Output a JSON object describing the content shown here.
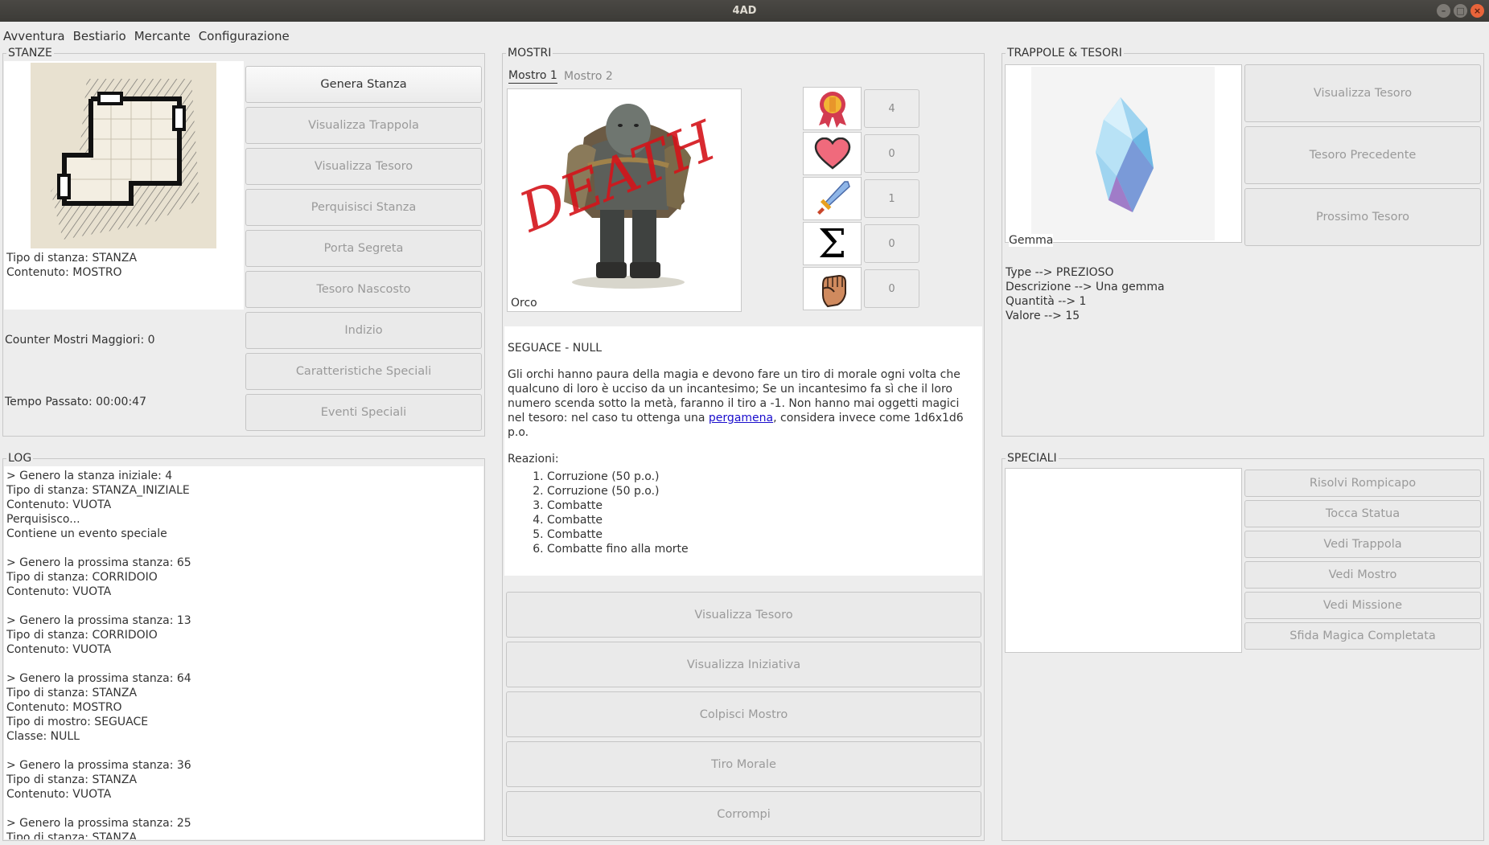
{
  "window": {
    "title": "4AD"
  },
  "menu": [
    "Avventura",
    "Bestiario",
    "Mercante",
    "Configurazione"
  ],
  "stanze": {
    "title": "STANZE",
    "tipo": "Tipo di stanza: STANZA",
    "contenuto": "Contenuto: MOSTRO",
    "counter": "Counter Mostri Maggiori: 0",
    "tempo": "Tempo Passato: 00:00:47",
    "buttons": [
      "Genera Stanza",
      "Visualizza Trappola",
      "Visualizza Tesoro",
      "Perquisisci Stanza",
      "Porta Segreta",
      "Tesoro Nascosto",
      "Indizio",
      "Caratteristiche Speciali",
      "Eventi Speciali"
    ]
  },
  "mostri": {
    "title": "MOSTRI",
    "tabs": [
      "Mostro 1",
      "Mostro 2"
    ],
    "image_caption": "Orco",
    "image_overlay": "DEATH",
    "stats": [
      {
        "icon": "medal-icon",
        "value": "4"
      },
      {
        "icon": "heart-icon",
        "value": "0"
      },
      {
        "icon": "sword-icon",
        "value": "1"
      },
      {
        "icon": "sigma-icon",
        "value": "0"
      },
      {
        "icon": "fist-icon",
        "value": "0"
      }
    ],
    "heading": "SEGUACE - NULL",
    "description_before": "Gli orchi hanno paura della magia e devono fare un tiro di morale ogni volta che qualcuno di loro è ucciso da un incantesimo; Se un incantesimo fa sì che il loro numero scenda sotto la metà, faranno il tiro a -1. Non hanno mai oggetti magici nel tesoro: nel caso tu ottenga una ",
    "description_link": "pergamena",
    "description_after": ", considera invece come 1d6x1d6 p.o.",
    "reactions_title": "Reazioni:",
    "reactions": [
      "Corruzione (50 p.o.)",
      "Corruzione (50 p.o.)",
      "Combatte",
      "Combatte",
      "Combatte",
      "Combatte fino alla morte"
    ],
    "buttons": [
      "Visualizza Tesoro",
      "Visualizza Iniziativa",
      "Colpisci Mostro",
      "Tiro Morale",
      "Corrompi"
    ]
  },
  "trappole": {
    "title": "TRAPPOLE & TESORI",
    "image_caption": "Gemma",
    "info": [
      "Type --> PREZIOSO",
      "Descrizione --> Una gemma",
      "Quantità --> 1",
      "Valore --> 15"
    ],
    "buttons": [
      "Visualizza Tesoro",
      "Tesoro Precedente",
      "Prossimo Tesoro"
    ]
  },
  "log": {
    "title": "LOG",
    "lines": [
      "> Genero la stanza iniziale: 4",
      "Tipo di stanza: STANZA_INIZIALE",
      "Contenuto: VUOTA",
      "Perquisisco...",
      "Contiene un evento speciale",
      "",
      "> Genero la prossima stanza: 65",
      "Tipo di stanza: CORRIDOIO",
      "Contenuto: VUOTA",
      "",
      "> Genero la prossima stanza: 13",
      "Tipo di stanza: CORRIDOIO",
      "Contenuto: VUOTA",
      "",
      "> Genero la prossima stanza: 64",
      "Tipo di stanza: STANZA",
      "Contenuto: MOSTRO",
      "Tipo di mostro: SEGUACE",
      "Classe: NULL",
      "",
      "> Genero la prossima stanza: 36",
      "Tipo di stanza: STANZA",
      "Contenuto: VUOTA",
      "",
      "> Genero la prossima stanza: 25",
      "Tipo di stanza: STANZA"
    ]
  },
  "speciali": {
    "title": "SPECIALI",
    "buttons": [
      "Risolvi Rompicapo",
      "Tocca Statua",
      "Vedi Trappola",
      "Vedi Mostro",
      "Vedi Missione",
      "Sfida Magica Completata"
    ]
  }
}
